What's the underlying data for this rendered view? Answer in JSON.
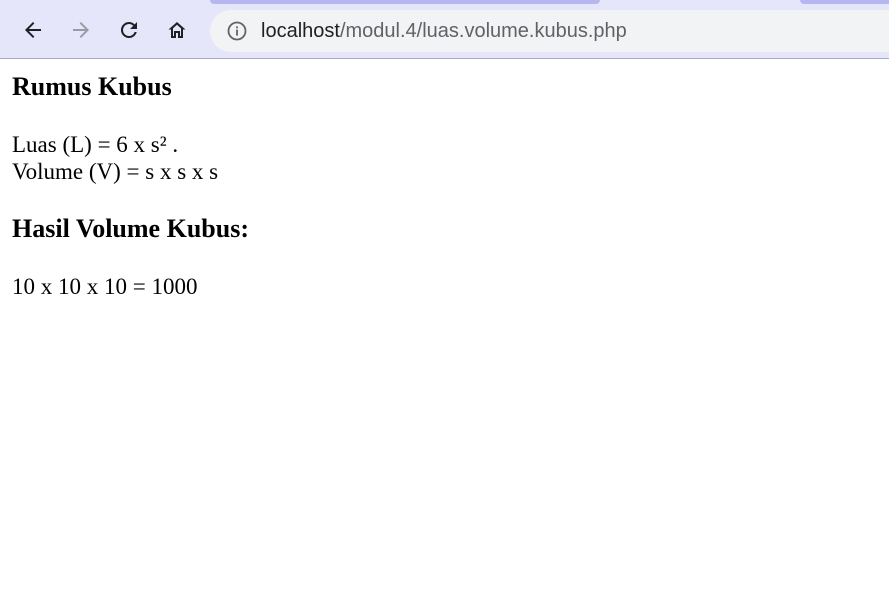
{
  "browser": {
    "url_host": "localhost",
    "url_path": "/modul.4/luas.volume.kubus.php",
    "icons": {
      "back": "back-arrow-icon",
      "forward": "forward-arrow-icon",
      "reload": "reload-icon",
      "home": "home-icon",
      "site_info": "info-icon"
    }
  },
  "page": {
    "heading_formula": "Rumus Kubus",
    "formula_area": "Luas (L) = 6 x s² .",
    "formula_volume": "Volume (V) = s x s x s",
    "heading_result": "Hasil Volume Kubus:",
    "result": "10 x 10 x 10 = 1000"
  }
}
